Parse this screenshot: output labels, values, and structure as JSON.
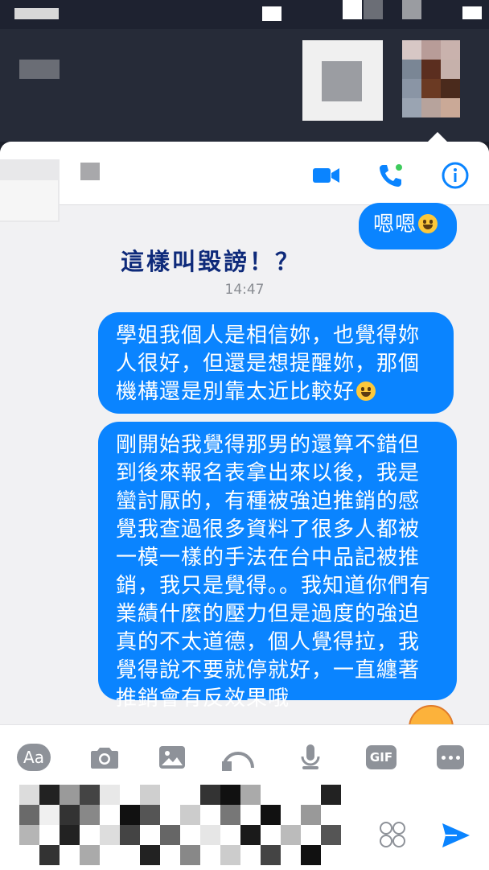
{
  "colors": {
    "accent": "#0a84ff",
    "bubble_text": "#ffffff",
    "timestamp": "#8a8d93",
    "overlay_text": "#0e2a7a",
    "tool_gray": "#8e9299"
  },
  "header": {
    "actions": [
      {
        "name": "video-call-icon"
      },
      {
        "name": "voice-call-icon"
      },
      {
        "name": "info-icon"
      }
    ]
  },
  "messages": {
    "reply_1": "嗯嗯",
    "overlay_caption": "這樣叫毀謗！？",
    "timestamp": "14:47",
    "msg_1": "學姐我個人是相信妳，也覺得妳人很好，但還是想提醒妳，那個機構還是別靠太近比較好",
    "msg_2": "剛開始我覺得那男的還算不錯但到後來報名表拿出來以後，我是蠻討厭的，有種被強迫推銷的感覺我查過很多資料了很多人都被一模一樣的手法在台中品記被推銷，我只是覺得。。我知道你們有業績什麼的壓力但是過度的強迫真的不太道德，個人覺得拉，我覺得說不要就停就好，一直纏著推銷會有反效果哦"
  },
  "composer": {
    "aa_label": "Aa",
    "gif_label": "GIF",
    "tools": [
      "text-style-icon",
      "camera-icon",
      "gallery-icon",
      "location-icon",
      "microphone-icon",
      "gif-icon",
      "more-icon"
    ]
  }
}
